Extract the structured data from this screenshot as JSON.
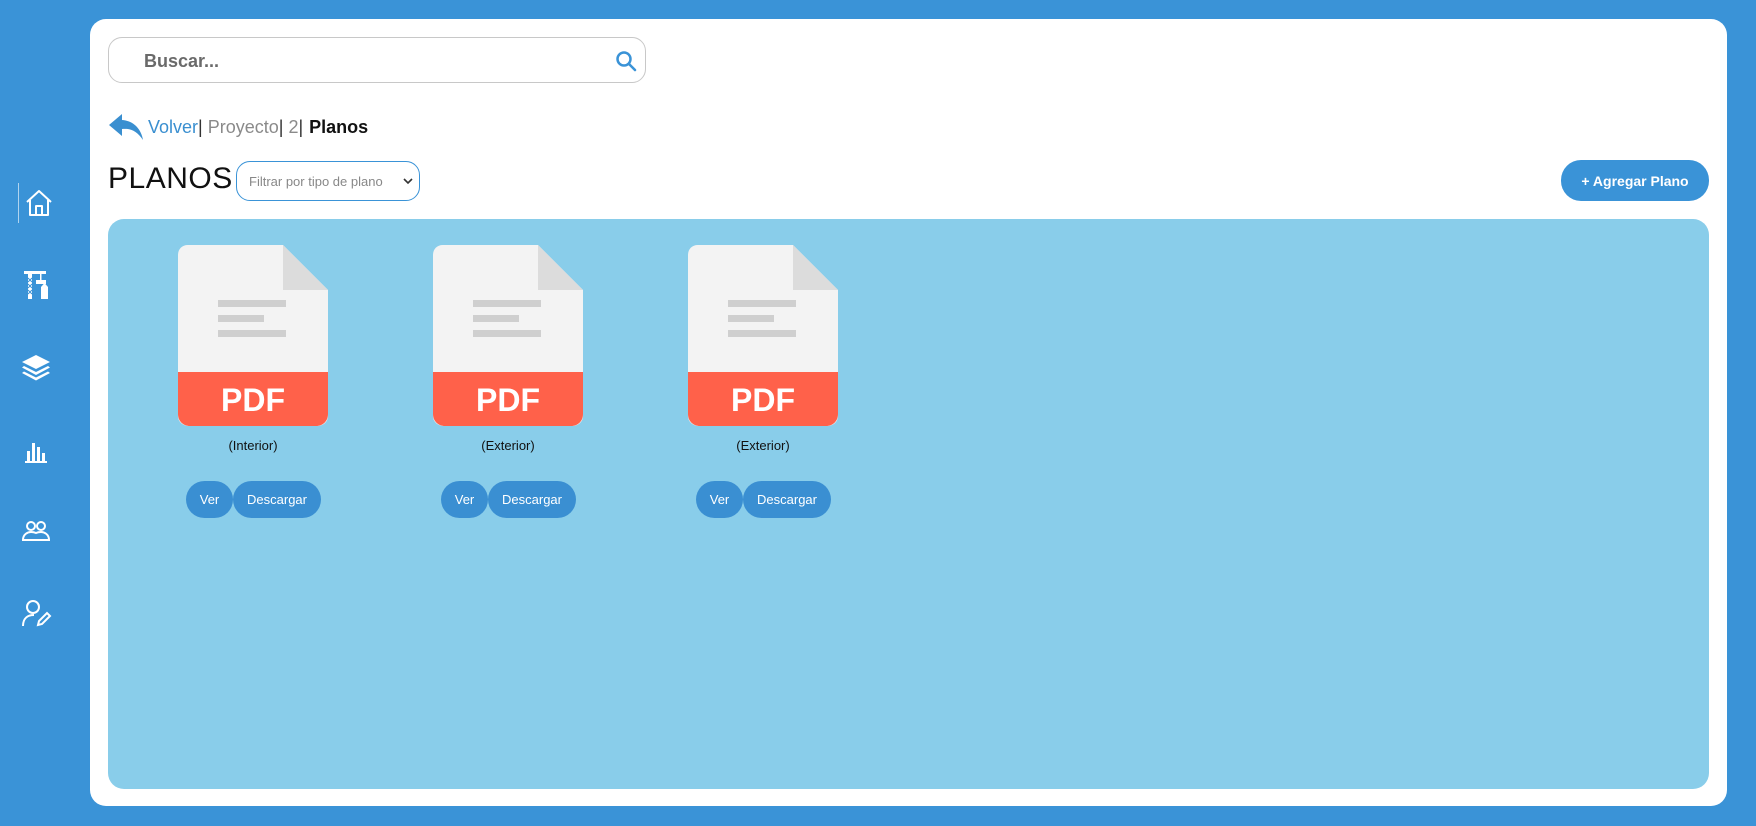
{
  "sidebar": {
    "items": [
      {
        "icon": "home-icon",
        "active": true
      },
      {
        "icon": "construction-crane-icon",
        "active": false
      },
      {
        "icon": "layers-icon",
        "active": false
      },
      {
        "icon": "bar-chart-icon",
        "active": false
      },
      {
        "icon": "users-icon",
        "active": false
      },
      {
        "icon": "user-edit-icon",
        "active": false
      }
    ]
  },
  "search": {
    "placeholder": "Buscar..."
  },
  "breadcrumb": {
    "back": "Volver",
    "sep1": "|",
    "project": " Proyecto",
    "sep2": "|",
    "id": " 2",
    "sep3": "|",
    "current": "Planos"
  },
  "page": {
    "title": "PLANOS",
    "filter_placeholder": "Filtrar por tipo de plano",
    "add_button": "+ Agregar Plano"
  },
  "files": [
    {
      "type": "PDF",
      "caption": "(Interior)",
      "view": "Ver",
      "download": "Descargar"
    },
    {
      "type": "PDF",
      "caption": "(Exterior)",
      "view": "Ver",
      "download": "Descargar"
    },
    {
      "type": "PDF",
      "caption": "(Exterior)",
      "view": "Ver",
      "download": "Descargar"
    }
  ],
  "colors": {
    "accent": "#3a93d7",
    "panel": "#89cdea",
    "pdf_band": "#ff614a"
  }
}
